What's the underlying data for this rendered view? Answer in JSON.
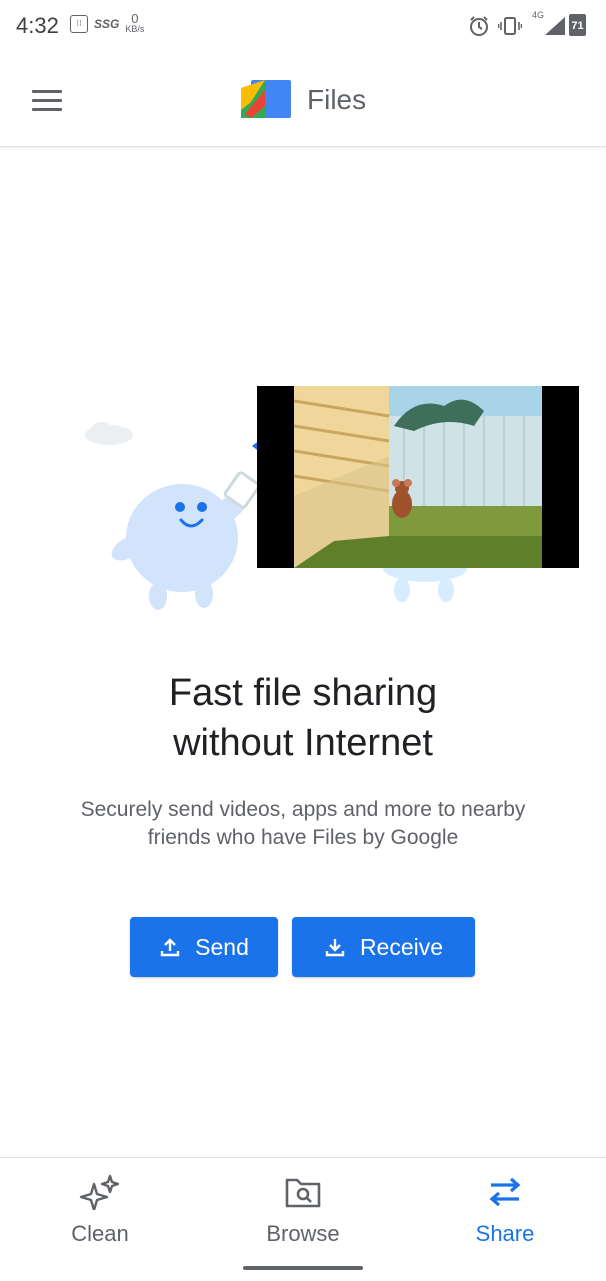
{
  "status_bar": {
    "time": "4:32",
    "carrier": "SSG",
    "net_speed_value": "0",
    "net_speed_unit": "KB/s",
    "network_type": "4G",
    "battery_level": "71"
  },
  "app_bar": {
    "title": "Files"
  },
  "share_intro": {
    "headline_line1": "Fast file sharing",
    "headline_line2": "without Internet",
    "description": "Securely send videos, apps and more to nearby friends who have Files by Google"
  },
  "actions": {
    "send_label": "Send",
    "receive_label": "Receive"
  },
  "bottom_nav": {
    "items": [
      {
        "label": "Clean",
        "icon": "sparkle-icon",
        "active": false
      },
      {
        "label": "Browse",
        "icon": "folder-search-icon",
        "active": false
      },
      {
        "label": "Share",
        "icon": "swap-arrows-icon",
        "active": true
      }
    ]
  },
  "colors": {
    "accent": "#1a73e8",
    "text_primary": "#202124",
    "text_secondary": "#5f6368"
  }
}
